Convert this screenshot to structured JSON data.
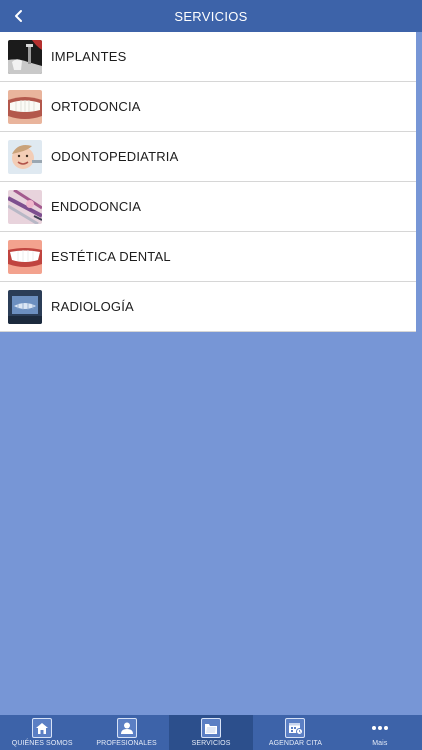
{
  "header": {
    "title": "SERVICIOS",
    "back_icon": "chevron-left-icon"
  },
  "services": [
    {
      "label": "IMPLANTES",
      "image": "dental-implant-image"
    },
    {
      "label": "ORTODONCIA",
      "image": "teeth-smile-image"
    },
    {
      "label": "ODONTOPEDIATRIA",
      "image": "child-dentist-image"
    },
    {
      "label": "ENDODONCIA",
      "image": "dental-tools-image"
    },
    {
      "label": "ESTÉTICA DENTAL",
      "image": "white-smile-image"
    },
    {
      "label": "RADIOLOGÍA",
      "image": "xray-screen-image"
    }
  ],
  "tabbar": {
    "tabs": [
      {
        "label": "QUIÉNES SOMOS",
        "icon": "home-icon"
      },
      {
        "label": "PROFESIONALES",
        "icon": "person-icon"
      },
      {
        "label": "SERVICIOS",
        "icon": "folder-icon",
        "active": true
      },
      {
        "label": "AGENDAR CITA",
        "icon": "calendar-icon"
      },
      {
        "label": "Mais",
        "icon": "more-icon"
      }
    ]
  },
  "colors": {
    "header_bg": "#3d63a9",
    "page_bg": "#7796d6",
    "active_tab_bg": "#2c4f8c"
  }
}
